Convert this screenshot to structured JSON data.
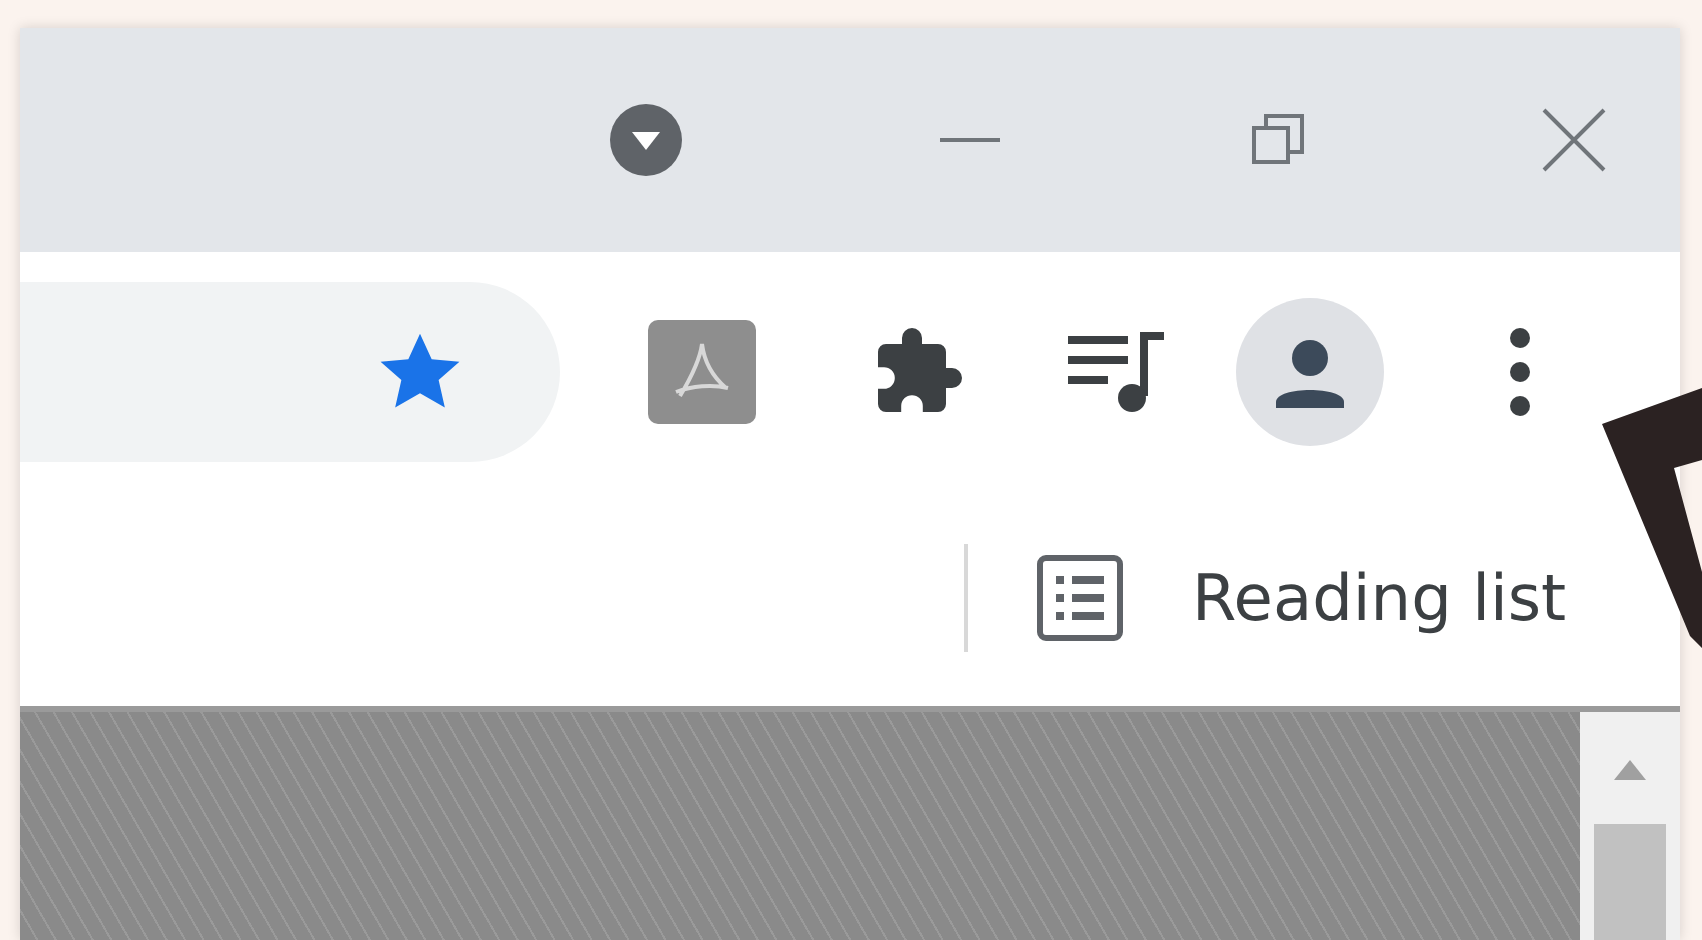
{
  "omnibox": {
    "bookmarked": true
  },
  "bookmarks_bar": {
    "reading_list": {
      "label": "Reading list"
    }
  }
}
